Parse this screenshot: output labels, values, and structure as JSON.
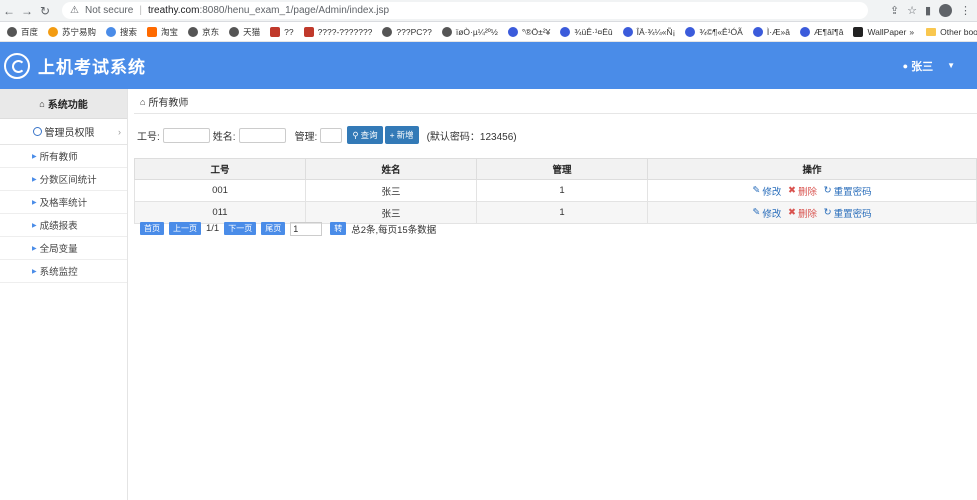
{
  "browser": {
    "security": "Not secure",
    "url_host": "treathy.com",
    "url_path": ":8080/henu_exam_1/page/Admin/index.jsp",
    "bookmarks": [
      "百度",
      "苏宁易购",
      "搜索",
      "淘宝",
      "京东",
      "天猫",
      "??",
      "????-???????",
      "???PC??",
      "ïøÒ·µ¼²º½",
      "°®Ö±²¥",
      "¾üÊ·¹¤Ëû",
      "ÎÄ·¾¼«Ñ¡",
      "¾©¶«Ê¹ÓÃ",
      "Ì·Æ»â",
      "Æ¶âî¶â",
      "WallPaper"
    ],
    "more": "»",
    "other_bookmarks": "Other bookmarks"
  },
  "header": {
    "title": "上机考试系统",
    "user": "张三"
  },
  "sidebar": {
    "heading": "系统功能",
    "group": "管理员权限",
    "items": [
      "所有教师",
      "分数区间统计",
      "及格率统计",
      "成绩报表",
      "全局变量",
      "系统监控"
    ]
  },
  "breadcrumb": "所有教师",
  "search": {
    "id_label": "工号:",
    "name_label": "姓名:",
    "admin_label": "管理:",
    "query_btn": "查询",
    "add_btn": "新增",
    "hint": "(默认密码：123456)"
  },
  "table": {
    "headers": [
      "工号",
      "姓名",
      "管理",
      "操作"
    ],
    "rows": [
      {
        "id": "001",
        "name": "张三",
        "admin": "1"
      },
      {
        "id": "011",
        "name": "张三",
        "admin": "1"
      }
    ],
    "ops": {
      "edit": "修改",
      "delete": "删除",
      "reset": "重置密码"
    }
  },
  "pager": {
    "first": "首页",
    "prev": "上一页",
    "pages": "1/1",
    "next": "下一页",
    "last": "尾页",
    "input_value": "1",
    "go": "转",
    "summary": "总2条,每页15条数据"
  },
  "colors": {
    "header_bg": "#4a8ce8",
    "button": "#337ab7",
    "delete": "#d9534f"
  }
}
